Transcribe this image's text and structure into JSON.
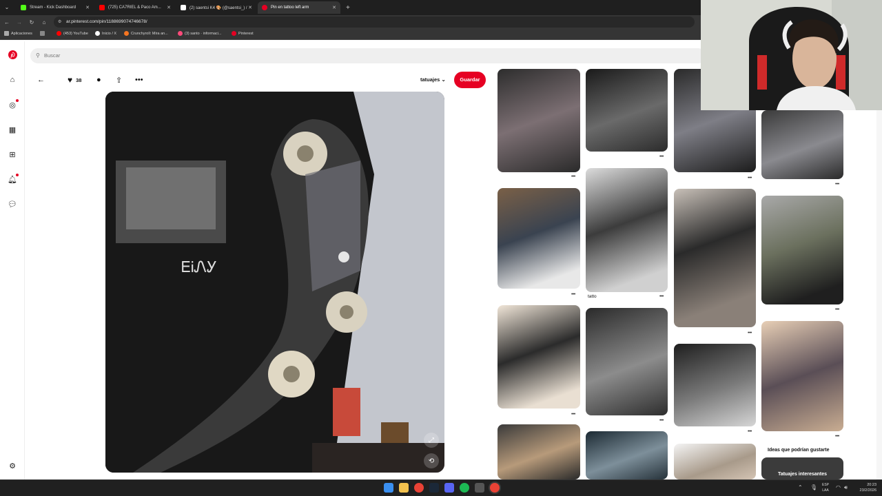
{
  "browser": {
    "tabs": [
      {
        "label": "Stream - Kick Dashboard",
        "color": "#53fc18"
      },
      {
        "label": "(725) CA7RIEL & Paco Am...",
        "color": "#ff0000"
      },
      {
        "label": "(2) saentsi K4 🎨 (@saentsi_) /",
        "color": "#ffffff"
      },
      {
        "label": "Pin en tattoo left arm",
        "color": "#e60023"
      }
    ],
    "new_tab": "+",
    "url": "ar.pinterest.com/pin/1188699074746678/",
    "bookmarks": [
      {
        "label": "Aplicaciones",
        "color": "#aaaaaa"
      },
      {
        "label": "(453) YouTube",
        "color": "#ff0000"
      },
      {
        "label": "Inicio / X",
        "color": "#ffffff"
      },
      {
        "label": "Crunchyroll: Mira an...",
        "color": "#f47521"
      },
      {
        "label": "(3) santo · informaci...",
        "color": "#ff4a7a"
      },
      {
        "label": "Pinterest",
        "color": "#e60023"
      }
    ]
  },
  "pinterest": {
    "search_placeholder": "Buscar",
    "likes": "38",
    "board": "tatuajes",
    "save_label": "Guardar",
    "grid": {
      "caption_tatto": "tatto",
      "suggest_title": "Ideas que podrían gustarte",
      "suggest_sub": "Tatuajes interesantes"
    }
  },
  "image_text": "ᎬᎥᏁᎩ",
  "taskbar": {
    "lang_1": "ESP",
    "lang_2": "LAA",
    "time": "20:23",
    "date": "23/2/2026"
  },
  "colors": {
    "accent": "#e60023"
  },
  "icons": [
    "back-arrow-icon",
    "heart-icon",
    "comment-icon",
    "share-icon",
    "more-icon",
    "chevron-down-icon",
    "home-icon",
    "explore-icon",
    "boards-icon",
    "create-icon",
    "notifications-icon",
    "messages-icon",
    "settings-icon",
    "pinterest-logo-icon",
    "search-icon",
    "expand-icon",
    "lens-icon"
  ]
}
